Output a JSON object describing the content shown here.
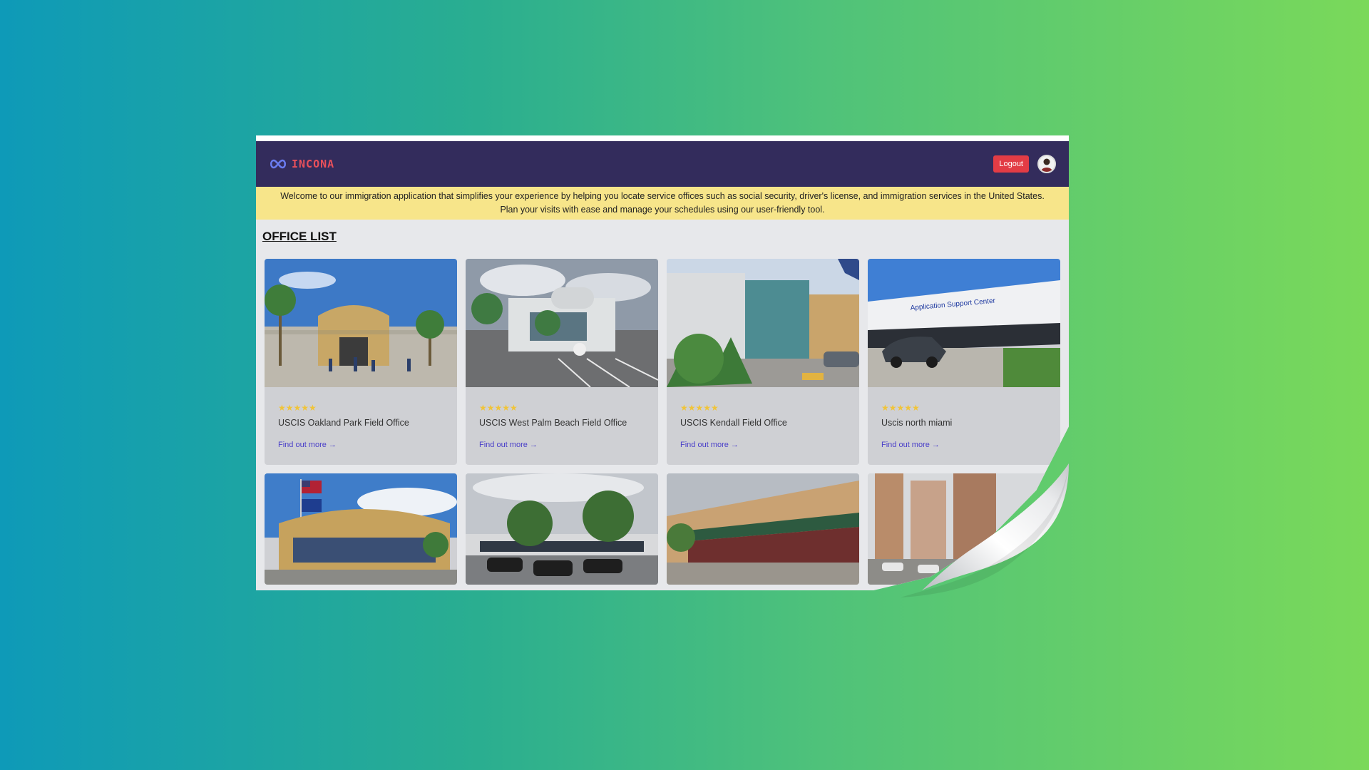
{
  "navbar": {
    "brand": "INCONA",
    "logout_label": "Logout",
    "colors": {
      "background": "#332c5c",
      "logout": "#e23c45",
      "brand": "#e8505b"
    }
  },
  "banner": {
    "line1": "Welcome to our immigration application that simplifies your experience by helping you locate service offices such as social security, driver's license, and immigration services in the United States.",
    "line2": "Plan your visits with ease and manage your schedules using our user-friendly tool."
  },
  "page": {
    "title": "OFFICE LIST"
  },
  "offices": [
    {
      "name": "USCIS Oakland Park Field Office",
      "rating": 5,
      "stars": "★★★★★",
      "link": "Find out more →"
    },
    {
      "name": "USCIS West Palm Beach Field Office",
      "rating": 5,
      "stars": "★★★★★",
      "link": "Find out more →"
    },
    {
      "name": "USCIS Kendall Field Office",
      "rating": 5,
      "stars": "★★★★★",
      "link": "Find out more →"
    },
    {
      "name": "Uscis north miami",
      "rating": 5,
      "stars": "★★★★★",
      "link": "Find out more →"
    }
  ],
  "photo_sign": "Application Support Center"
}
